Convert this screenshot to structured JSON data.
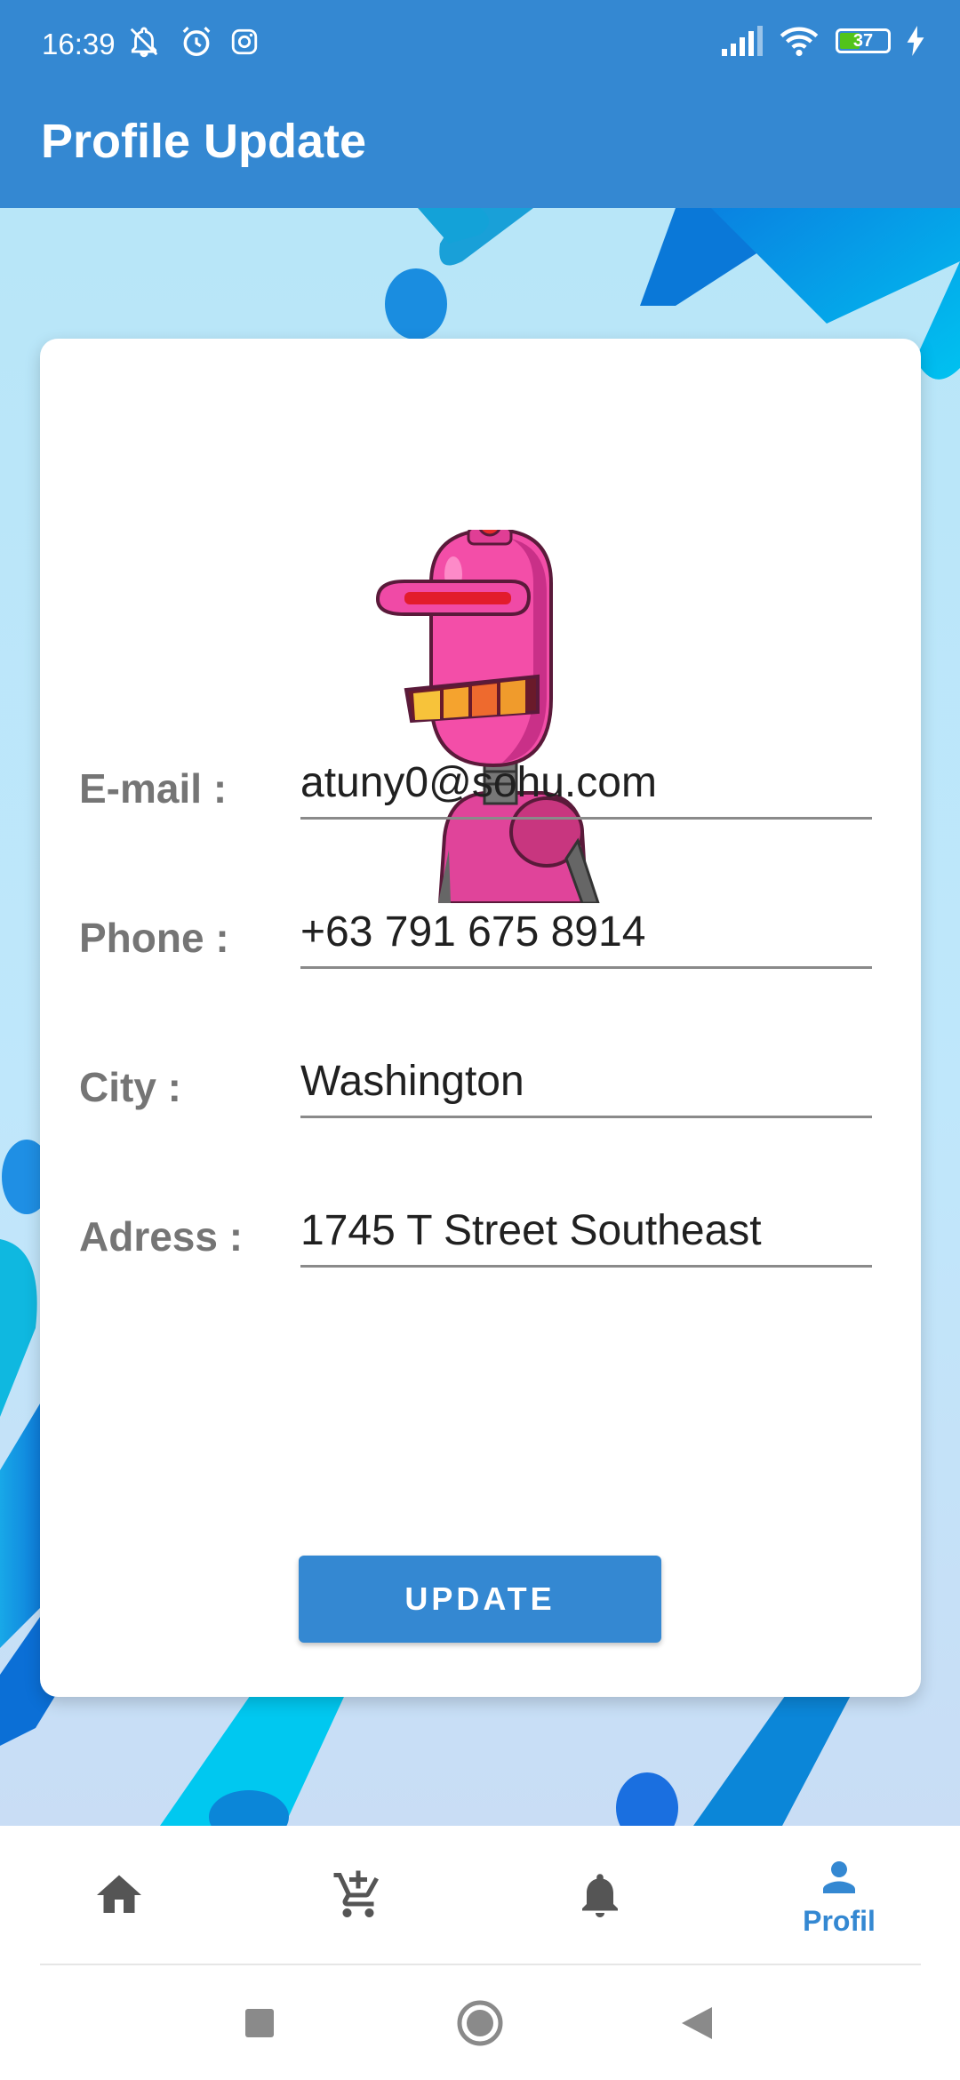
{
  "status_bar": {
    "time": "16:39",
    "battery": "37"
  },
  "app_bar": {
    "title": "Profile Update"
  },
  "form": {
    "email": {
      "label": "E-mail :",
      "value": "atuny0@sohu.com"
    },
    "phone": {
      "label": "Phone :",
      "value": "+63 791 675 8914"
    },
    "city": {
      "label": "City :",
      "value": "Washington"
    },
    "address": {
      "label": "Adress :",
      "value": "1745 T Street Southeast"
    },
    "update_label": "UPDATE"
  },
  "bottom_nav": {
    "items": [
      {
        "icon": "home-icon"
      },
      {
        "icon": "add-to-cart-icon"
      },
      {
        "icon": "bell-icon"
      },
      {
        "icon": "person-icon",
        "label": "Profil",
        "active": true
      }
    ]
  },
  "colors": {
    "primary": "#3488d2",
    "label_gray": "#757575"
  }
}
